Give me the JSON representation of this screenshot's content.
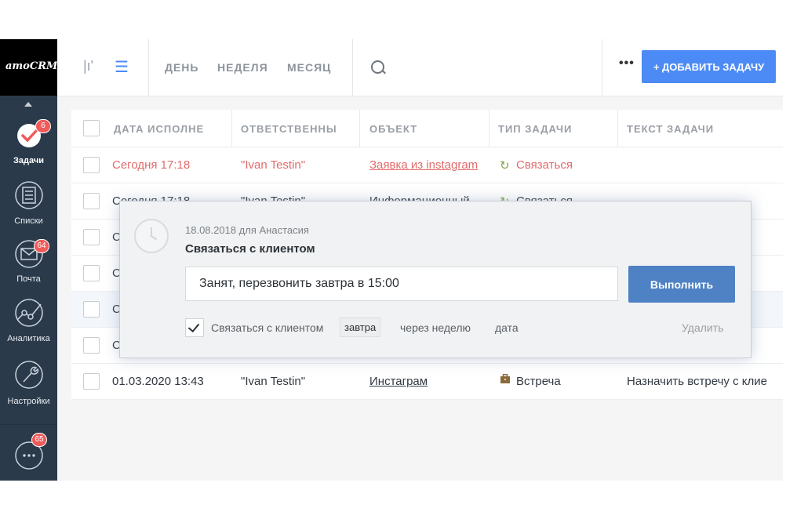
{
  "app": {
    "logo": "amoCRM."
  },
  "sidebar": {
    "items": [
      {
        "label": "Задачи",
        "icon": "tasks-check-icon",
        "badge": "6"
      },
      {
        "label": "Списки",
        "icon": "lists-icon",
        "badge": ""
      },
      {
        "label": "Почта",
        "icon": "mail-icon",
        "badge": "64"
      },
      {
        "label": "Аналитика",
        "icon": "analytics-icon",
        "badge": ""
      },
      {
        "label": "Настройки",
        "icon": "settings-wrench-icon",
        "badge": ""
      }
    ],
    "chat_badge": "65"
  },
  "toolbar": {
    "periods": [
      "ДЕНЬ",
      "НЕДЕЛЯ",
      "МЕСЯЦ"
    ],
    "more": "•••",
    "add_task": "+ ДОБАВИТЬ ЗАДАЧУ"
  },
  "table": {
    "columns": [
      "ДАТА ИСПОЛНЕ",
      "ОТВЕТСТВЕННЫ",
      "ОБЪЕКТ",
      "ТИП ЗАДАЧИ",
      "ТЕКСТ ЗАДАЧИ"
    ],
    "rows": [
      {
        "date": "Сегодня 17:18",
        "responsible": "\"Ivan Testin\"",
        "object": "Заявка из instagram",
        "type": "Связаться",
        "text": ""
      },
      {
        "date": "Сегодня 17:18",
        "responsible": "\"Ivan Testin\"",
        "object": "Информационный",
        "type": "Связаться",
        "text": ""
      },
      {
        "date": "С",
        "responsible": "",
        "object": "",
        "type": "",
        "text": ""
      },
      {
        "date": "С",
        "responsible": "",
        "object": "",
        "type": "",
        "text": ""
      },
      {
        "date": "С",
        "responsible": "",
        "object": "",
        "type": "",
        "text": ""
      },
      {
        "date": "С",
        "responsible": "",
        "object": "",
        "type": "",
        "text": ""
      },
      {
        "date": "01.03.2020 13:43",
        "responsible": "\"Ivan Testin\"",
        "object": "Инстаграм",
        "type": "Встреча",
        "text": "Назначить встречу с клие"
      }
    ]
  },
  "modal": {
    "meta": "18.08.2018 для Анастасия",
    "title": "Связаться с клиентом",
    "input_value": "Занят, перезвонить завтра в 15:00",
    "submit": "Выполнить",
    "type_label": "Связаться с клиентом",
    "chip": "завтра",
    "next_week": "через неделю",
    "date": "дата",
    "delete": "Удалить"
  },
  "colors": {
    "accent": "#4c8bf5",
    "sidebar": "#2b3a4a",
    "overdue": "#e26a6a",
    "badge": "#f05a5a",
    "contact_icon": "#7fa44e"
  }
}
